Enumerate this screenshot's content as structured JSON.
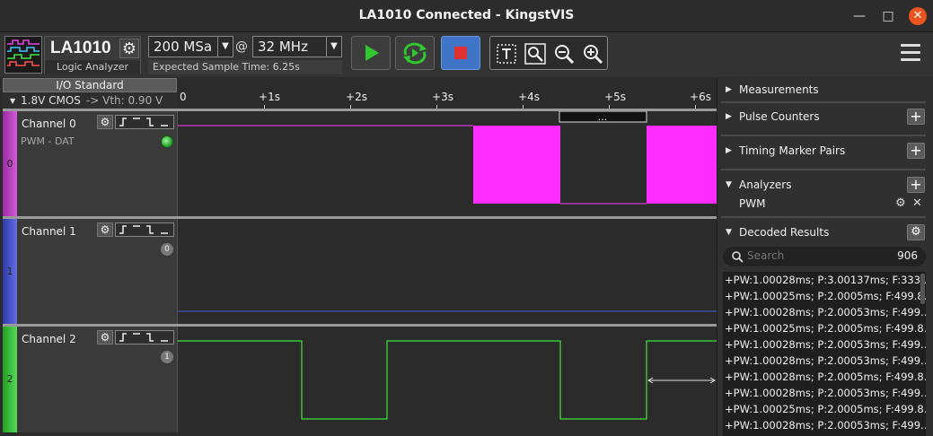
{
  "window": {
    "title": "LA1010 Connected - KingstVIS"
  },
  "device": {
    "name": "LA1010",
    "subtitle": "Logic Analyzer"
  },
  "acquisition": {
    "sample_count": "200 MSa",
    "at": "@",
    "sample_rate": "32 MHz",
    "expected_time": "Expected Sample Time: 6.25s"
  },
  "io": {
    "header": "I/O Standard",
    "standard": "1.8V CMOS",
    "vth": "-> Vth: 0.90 V"
  },
  "ruler": {
    "origin": "0",
    "ticks": [
      "+1s",
      "+2s",
      "+3s",
      "+4s",
      "+5s",
      "+6s"
    ],
    "marker_label": "..."
  },
  "channels": [
    {
      "index": "0",
      "name": "Channel 0",
      "label": "PWM - DAT",
      "color": "#c83cc8",
      "trace": "#ff3cff",
      "trigger_glyphs": "⨍‾⨏_"
    },
    {
      "index": "1",
      "name": "Channel 1",
      "label": "",
      "badge": "0",
      "color": "#4b56c8",
      "trace": "#4a5ad8",
      "trigger_glyphs": "⨍‾⨏_"
    },
    {
      "index": "2",
      "name": "Channel 2",
      "label": "",
      "badge": "1",
      "color": "#3cc83c",
      "trace": "#3ce23c",
      "trigger_glyphs": "⨍‾⨏_"
    }
  ],
  "sidebar": {
    "measurements": "Measurements",
    "pulse_counters": "Pulse Counters",
    "timing_marker_pairs": "Timing Marker Pairs",
    "analyzers": "Analyzers",
    "analyzer_item": "PWM",
    "decoded_results": "Decoded Results",
    "search_placeholder": "Search",
    "result_count": "906",
    "results": [
      "+PW:1.00028ms; P:3.00137ms; F:333....",
      "+PW:1.00025ms; P:2.0005ms; F:499.8...",
      "+PW:1.00028ms; P:2.00053ms; F:499....",
      "+PW:1.00025ms; P:2.0005ms; F:499.8...",
      "+PW:1.00028ms; P:2.00053ms; F:499....",
      "+PW:1.00028ms; P:2.00053ms; F:499....",
      "+PW:1.00028ms; P:2.0005ms; F:499.8...",
      "+PW:1.00028ms; P:2.00053ms; F:499....",
      "+PW:1.00025ms; P:2.0005ms; F:499.8...",
      "+PW:1.00028ms; P:2.00053ms; F:499...."
    ]
  },
  "icons": {
    "run": "play-icon",
    "loop": "loop-run-icon",
    "stop": "stop-icon",
    "text_tool": "text-cursor-icon",
    "zoom_fit": "zoom-fit-icon",
    "zoom_out": "zoom-out-icon",
    "zoom_in": "zoom-in-icon",
    "menu": "hamburger-menu-icon"
  }
}
